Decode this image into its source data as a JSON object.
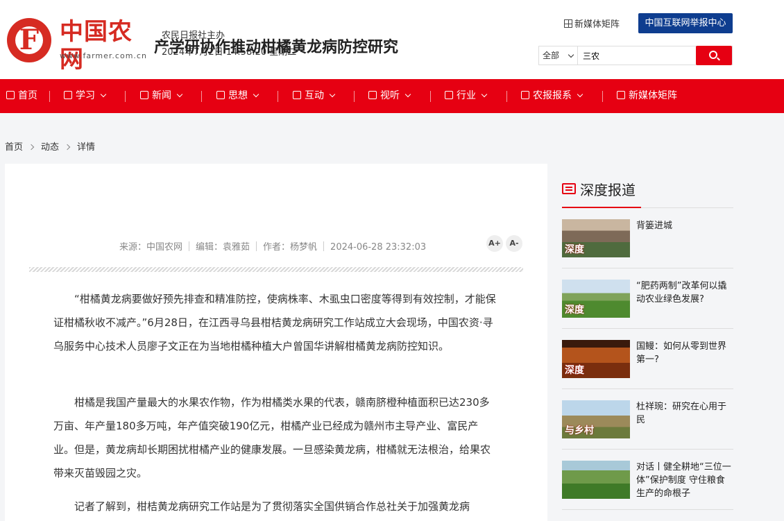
{
  "header": {
    "logo_cn": "中国农网",
    "logo_url": "www.farmer.com.cn",
    "host": "农民日报社主办",
    "datetime": "2024年7月2日 14:58:20 星期二",
    "media_matrix": "新媒体矩阵",
    "report_center": "中国互联网举报中心",
    "search": {
      "scope": "全部",
      "value": "三农"
    }
  },
  "nav": [
    {
      "label": "首页",
      "icon": "home-icon"
    },
    {
      "label": "学习",
      "icon": "book-icon"
    },
    {
      "label": "新闻",
      "icon": "news-icon"
    },
    {
      "label": "思想",
      "icon": "thought-icon"
    },
    {
      "label": "互动",
      "icon": "interact-icon"
    },
    {
      "label": "视听",
      "icon": "media-icon"
    },
    {
      "label": "行业",
      "icon": "industry-icon"
    },
    {
      "label": "农报报系",
      "icon": "newspaper-icon"
    },
    {
      "label": "新媒体矩阵",
      "icon": "phone-icon"
    }
  ],
  "breadcrumb": [
    "首页",
    "动态",
    "详情"
  ],
  "article": {
    "title": "产学研协作推动柑橘黄龙病防控研究",
    "source": "来源：中国农网",
    "editor": "编辑：袁雅茹",
    "author": "作者：杨梦帆",
    "time": "2024-06-28 23:32:03",
    "font_plus": "A+",
    "font_minus": "A-",
    "paragraphs": [
      "“柑橘黄龙病要做好预先排查和精准防控，使病株率、木虱虫口密度等得到有效控制，才能保证柑橘秋收不减产。”6月28日，在江西寻乌县柑桔黄龙病研究工作站成立大会现场，中国农资·寻乌服务中心技术人员廖子文正在为当地柑橘种植大户曾国华讲解柑橘黄龙病防控知识。",
      "柑橘是我国产量最大的水果农作物，作为柑橘类水果的代表，赣南脐橙种植面积已达230多万亩、年产量180多万吨，年产值突破190亿元，柑橘产业已经成为赣州市主导产业、富民产业。但是，黄龙病却长期困扰柑橘产业的健康发展。一旦感染黄龙病，柑橘就无法根治，给果农带来灭苗毁园之灾。",
      "记者了解到，柑桔黄龙病研究工作站是为了贯彻落实全国供销合作总社关于加强黄龙病"
    ]
  },
  "sidebar": {
    "title": "深度报道",
    "items": [
      {
        "text": "背篓进城",
        "tag": "深度"
      },
      {
        "text": "“肥药两制”改革何以撬动农业绿色发展?",
        "tag": "深度"
      },
      {
        "text": "国鳗：如何从零到世界第一?",
        "tag": "深度"
      },
      {
        "text": "杜祥琬：研究在心用于民",
        "tag": "与乡村"
      },
      {
        "text": "对话丨健全耕地“三位一体”保护制度 守住粮食生产的命根子",
        "tag": ""
      }
    ]
  }
}
